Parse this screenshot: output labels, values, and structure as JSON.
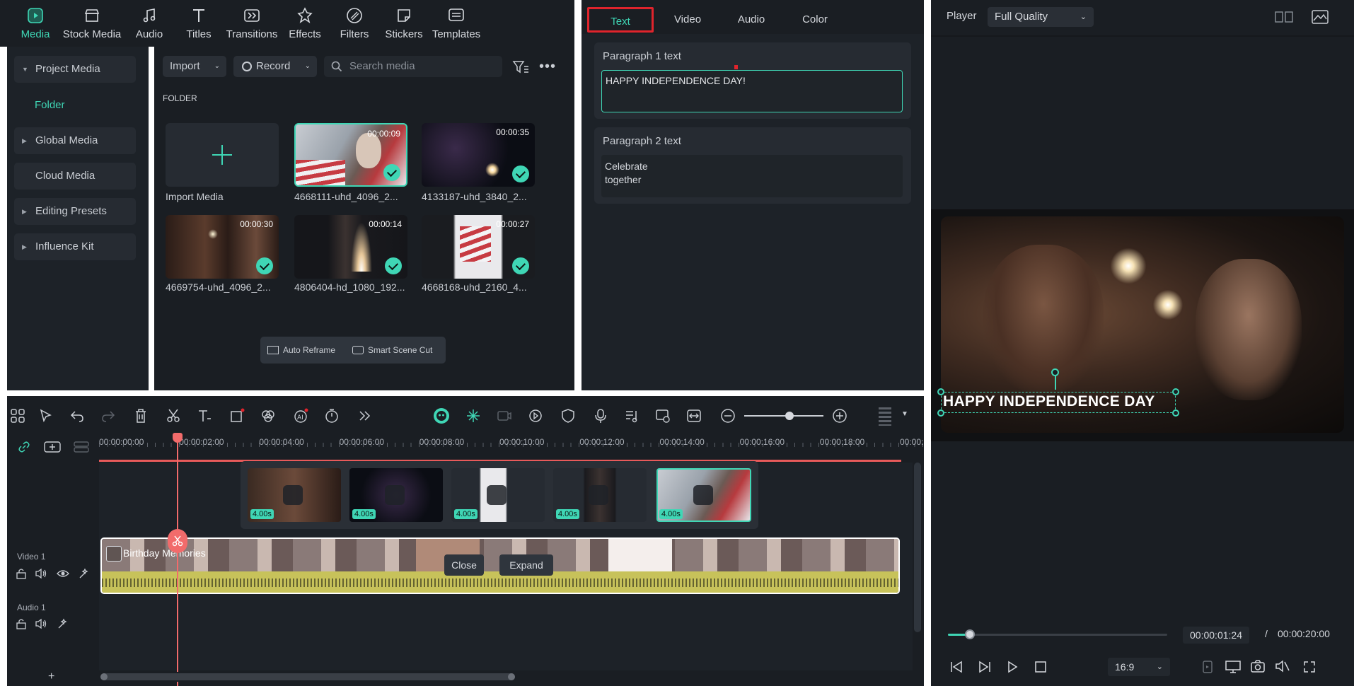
{
  "nav": {
    "items": [
      {
        "label": "Media",
        "icon": "media-icon",
        "active": true
      },
      {
        "label": "Stock Media",
        "icon": "stock-media-icon"
      },
      {
        "label": "Audio",
        "icon": "audio-icon"
      },
      {
        "label": "Titles",
        "icon": "titles-icon"
      },
      {
        "label": "Transitions",
        "icon": "transitions-icon"
      },
      {
        "label": "Effects",
        "icon": "effects-icon"
      },
      {
        "label": "Filters",
        "icon": "filters-icon"
      },
      {
        "label": "Stickers",
        "icon": "stickers-icon"
      },
      {
        "label": "Templates",
        "icon": "templates-icon"
      }
    ]
  },
  "sidebar": {
    "project_media": "Project Media",
    "folder": "Folder",
    "global_media": "Global Media",
    "cloud_media": "Cloud Media",
    "editing_presets": "Editing Presets",
    "influence_kit": "Influence Kit"
  },
  "media_toolbar": {
    "import_label": "Import",
    "record_label": "Record",
    "search_placeholder": "Search media"
  },
  "folder_heading": "FOLDER",
  "media_items": [
    {
      "name": "Import Media"
    },
    {
      "name": "4668111-uhd_4096_2...",
      "duration": "00:00:09"
    },
    {
      "name": "4133187-uhd_3840_2...",
      "duration": "00:00:35"
    },
    {
      "name": "4669754-uhd_4096_2...",
      "duration": "00:00:30"
    },
    {
      "name": "4806404-hd_1080_192...",
      "duration": "00:00:14"
    },
    {
      "name": "4668168-uhd_2160_4...",
      "duration": "00:00:27"
    }
  ],
  "media_actions": {
    "auto_reframe": "Auto Reframe",
    "smart_scene_cut": "Smart Scene Cut"
  },
  "props": {
    "tabs": [
      "Text",
      "Video",
      "Audio",
      "Color"
    ],
    "active_tab": "Text",
    "para1_label": "Paragraph 1 text",
    "para1_value": "HAPPY INDEPENDENCE DAY!",
    "para2_label": "Paragraph 2 text",
    "para2_line1": "Celebrate",
    "para2_line2": "together"
  },
  "player": {
    "label": "Player",
    "quality": "Full Quality",
    "overlay_text": "HAPPY INDEPENDENCE DAY",
    "current_time": "00:00:01:24",
    "separator": "/",
    "total_time": "00:00:20:00",
    "aspect": "16:9",
    "progress": 0.1
  },
  "timeline": {
    "ruler": [
      "00:00:00:00",
      "00:00:02:00",
      "00:00:04:00",
      "00:00:06:00",
      "00:00:08:00",
      "00:00:10:00",
      "00:00:12:00",
      "00:00:14:00",
      "00:00:16:00",
      "00:00:18:00",
      "00:00:"
    ],
    "popup_clips": [
      "4.00s",
      "4.00s",
      "4.00s",
      "4.00s",
      "4.00s"
    ],
    "video_track": "Video 1",
    "audio_track": "Audio 1",
    "clip_title": "Birthday Memories",
    "close_label": "Close",
    "expand_label": "Expand",
    "add_track": "+"
  },
  "colors": {
    "accent": "#3fd6b5",
    "highlight": "#e0242c",
    "playhead": "#f26b6b",
    "waveform": "#c7c25a"
  }
}
